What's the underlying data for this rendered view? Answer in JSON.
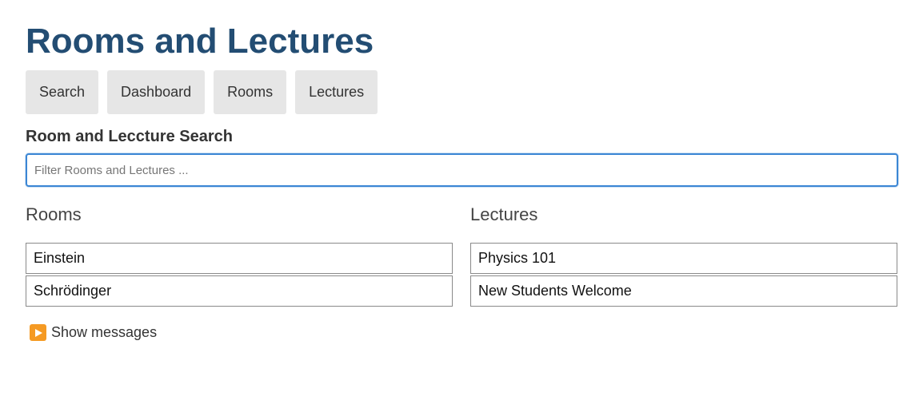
{
  "header": {
    "title": "Rooms and Lectures"
  },
  "nav": {
    "items": [
      {
        "label": "Search"
      },
      {
        "label": "Dashboard"
      },
      {
        "label": "Rooms"
      },
      {
        "label": "Lectures"
      }
    ]
  },
  "search": {
    "heading": "Room and Leccture Search",
    "value": "",
    "placeholder": "Filter Rooms and Lectures ..."
  },
  "rooms": {
    "heading": "Rooms",
    "items": [
      {
        "label": "Einstein"
      },
      {
        "label": "Schrödinger"
      }
    ]
  },
  "lectures": {
    "heading": "Lectures",
    "items": [
      {
        "label": "Physics 101"
      },
      {
        "label": "New Students Welcome"
      }
    ]
  },
  "messages": {
    "label": "Show messages",
    "icon": "play-icon"
  },
  "colors": {
    "title": "#234d73",
    "nav_bg": "#e6e6e6",
    "focus_border": "#3b86d4",
    "play_icon": "#f59a23"
  }
}
